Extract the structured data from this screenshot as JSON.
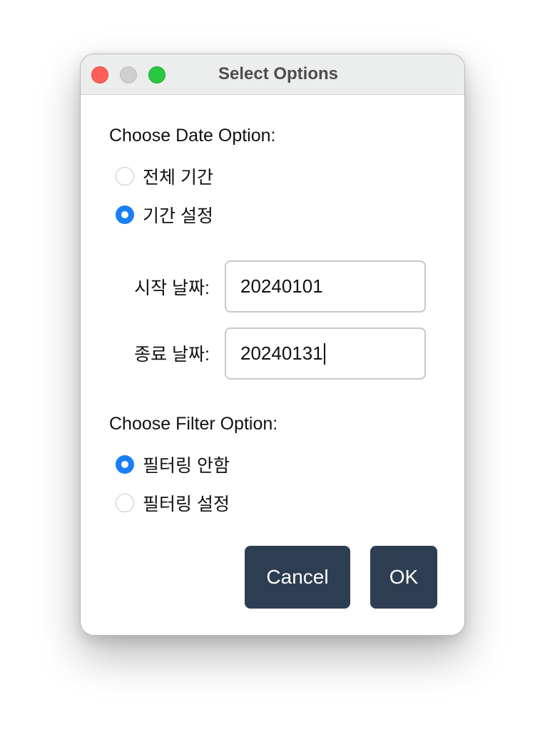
{
  "window": {
    "title": "Select Options"
  },
  "date_section": {
    "label": "Choose Date Option:",
    "options": [
      {
        "label": "전체 기간",
        "checked": false
      },
      {
        "label": "기간 설정",
        "checked": true
      }
    ],
    "start_label": "시작 날짜:",
    "start_value": "20240101",
    "end_label": "종료 날짜:",
    "end_value": "20240131"
  },
  "filter_section": {
    "label": "Choose Filter Option:",
    "options": [
      {
        "label": "필터링 안함",
        "checked": true
      },
      {
        "label": "필터링 설정",
        "checked": false
      }
    ]
  },
  "buttons": {
    "cancel_label": "Cancel",
    "ok_label": "OK"
  },
  "colors": {
    "accent": "#1a7ff5",
    "button_bg": "#2e3e52"
  }
}
